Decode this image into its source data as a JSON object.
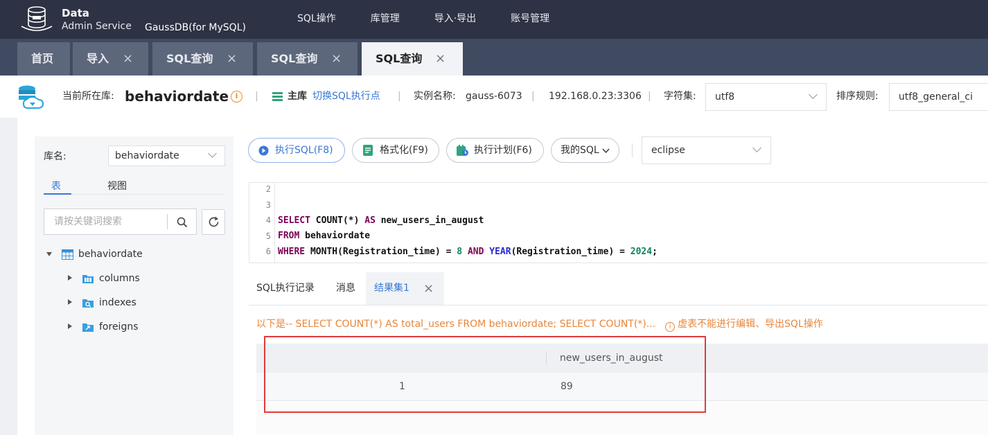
{
  "header": {
    "logo_line1": "Data",
    "logo_line2": "Admin Service",
    "product": "GaussDB(for MySQL)",
    "nav": [
      "SQL操作",
      "库管理",
      "导入·导出",
      "账号管理"
    ]
  },
  "tabs": [
    {
      "label": "首页",
      "closable": false
    },
    {
      "label": "导入",
      "closable": true
    },
    {
      "label": "SQL查询",
      "closable": true
    },
    {
      "label": "SQL查询",
      "closable": true
    },
    {
      "label": "SQL查询",
      "closable": true,
      "active": true
    }
  ],
  "info": {
    "current_db_label": "当前所在库:",
    "current_db": "behaviordate",
    "sep": "|",
    "master_label": "主库",
    "switch_link": "切换SQL执行点",
    "instance_label": "实例名称:",
    "instance_name": "gauss-6073",
    "address": "192.168.0.23:3306",
    "charset_label": "字符集:",
    "charset_value": "utf8",
    "collation_label": "排序规则:",
    "collation_value": "utf8_general_ci"
  },
  "left": {
    "db_label": "库名:",
    "db_value": "behaviordate",
    "tab_table": "表",
    "tab_view": "视图",
    "search_placeholder": "请按关键词搜索",
    "tree_root": "behaviordate",
    "tree_children": [
      "columns",
      "indexes",
      "foreigns"
    ]
  },
  "toolbar": {
    "run": "执行SQL(F8)",
    "format": "格式化(F9)",
    "plan": "执行计划(F6)",
    "my_sql": "我的SQL",
    "theme": "eclipse"
  },
  "editor": {
    "line_numbers": [
      "2",
      "3",
      "4",
      "5",
      "6"
    ],
    "l4": {
      "kw1": "SELECT",
      "fn": "COUNT",
      "mid": "(*) ",
      "kw2": "AS",
      "id": " new_users_in_august"
    },
    "l5": {
      "kw": "FROM",
      "id": " behaviordate"
    },
    "l6": {
      "kw1": "WHERE",
      "fn1": " MONTH",
      "a": "(Registration_time) = ",
      "n1": "8",
      "kw2": " AND",
      "fn2": " YEAR",
      "b": "(Registration_time) = ",
      "n2": "2024",
      "end": ";"
    }
  },
  "result_tabs": [
    "SQL执行记录",
    "消息",
    "结果集1"
  ],
  "result": {
    "message": "以下是-- SELECT COUNT(*) AS total_users FROM behaviordate; SELECT COUNT(*)...",
    "warning": "虚表不能进行编辑、导出SQL操作",
    "columns": [
      "",
      "new_users_in_august"
    ],
    "rows": [
      [
        "1",
        "89"
      ]
    ]
  },
  "colors": {
    "header_bg": "#2d3344",
    "accent": "#3a78d4",
    "warning": "#e8863a",
    "highlight_box": "#e03c3c"
  },
  "icons": [
    "logo-db-icon",
    "db-cloud-icon",
    "info-icon",
    "master-db-icon",
    "chevron-down-icon",
    "search-icon",
    "refresh-icon",
    "table-icon",
    "folder-icon",
    "play-icon",
    "format-icon",
    "plan-icon",
    "close-icon"
  ]
}
